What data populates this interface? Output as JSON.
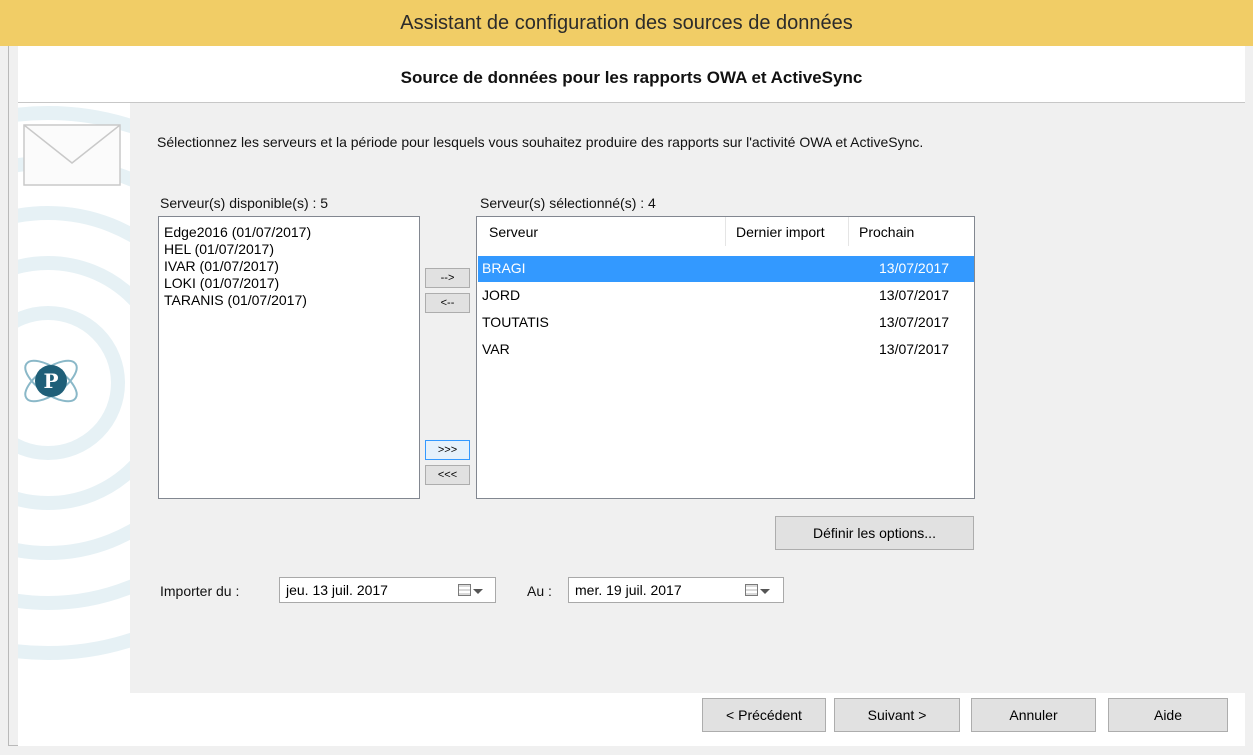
{
  "window": {
    "title": "Assistant de configuration des sources de données"
  },
  "header": {
    "title": "Source de données pour les rapports OWA et ActiveSync"
  },
  "instruction": "Sélectionnez les serveurs et la période pour lesquels vous souhaitez produire des rapports sur l'activité OWA et ActiveSync.",
  "available": {
    "label": "Serveur(s) disponible(s) : 5",
    "items": [
      "Edge2016 (01/07/2017)",
      "HEL (01/07/2017)",
      "IVAR (01/07/2017)",
      "LOKI (01/07/2017)",
      "TARANIS (01/07/2017)"
    ]
  },
  "transfer": {
    "add": "-->",
    "remove": "<--",
    "add_all": ">>>",
    "remove_all": "<<<"
  },
  "selected": {
    "label": "Serveur(s) sélectionné(s) : 4",
    "columns": [
      "Serveur",
      "Dernier import",
      "Prochain"
    ],
    "rows": [
      {
        "server": "BRAGI",
        "last": "",
        "next": "13/07/2017",
        "selected": true
      },
      {
        "server": "JORD",
        "last": "",
        "next": "13/07/2017",
        "selected": false
      },
      {
        "server": "TOUTATIS",
        "last": "",
        "next": "13/07/2017",
        "selected": false
      },
      {
        "server": "VAR",
        "last": "",
        "next": "13/07/2017",
        "selected": false
      }
    ]
  },
  "options_button": "Définir les options...",
  "dates": {
    "from_label": "Importer du :",
    "from_value": "jeu.  13  juil.  2017",
    "to_label": "Au :",
    "to_value": "mer.  19  juil.  2017"
  },
  "footer": {
    "previous": "< Précédent",
    "next": "Suivant >",
    "cancel": "Annuler",
    "help": "Aide"
  },
  "colors": {
    "titlebar": "#f1cd66",
    "selection": "#3399ff"
  },
  "icons": [
    "envelope-icon",
    "logo-icon",
    "calendar-icon",
    "chevron-down-icon"
  ]
}
